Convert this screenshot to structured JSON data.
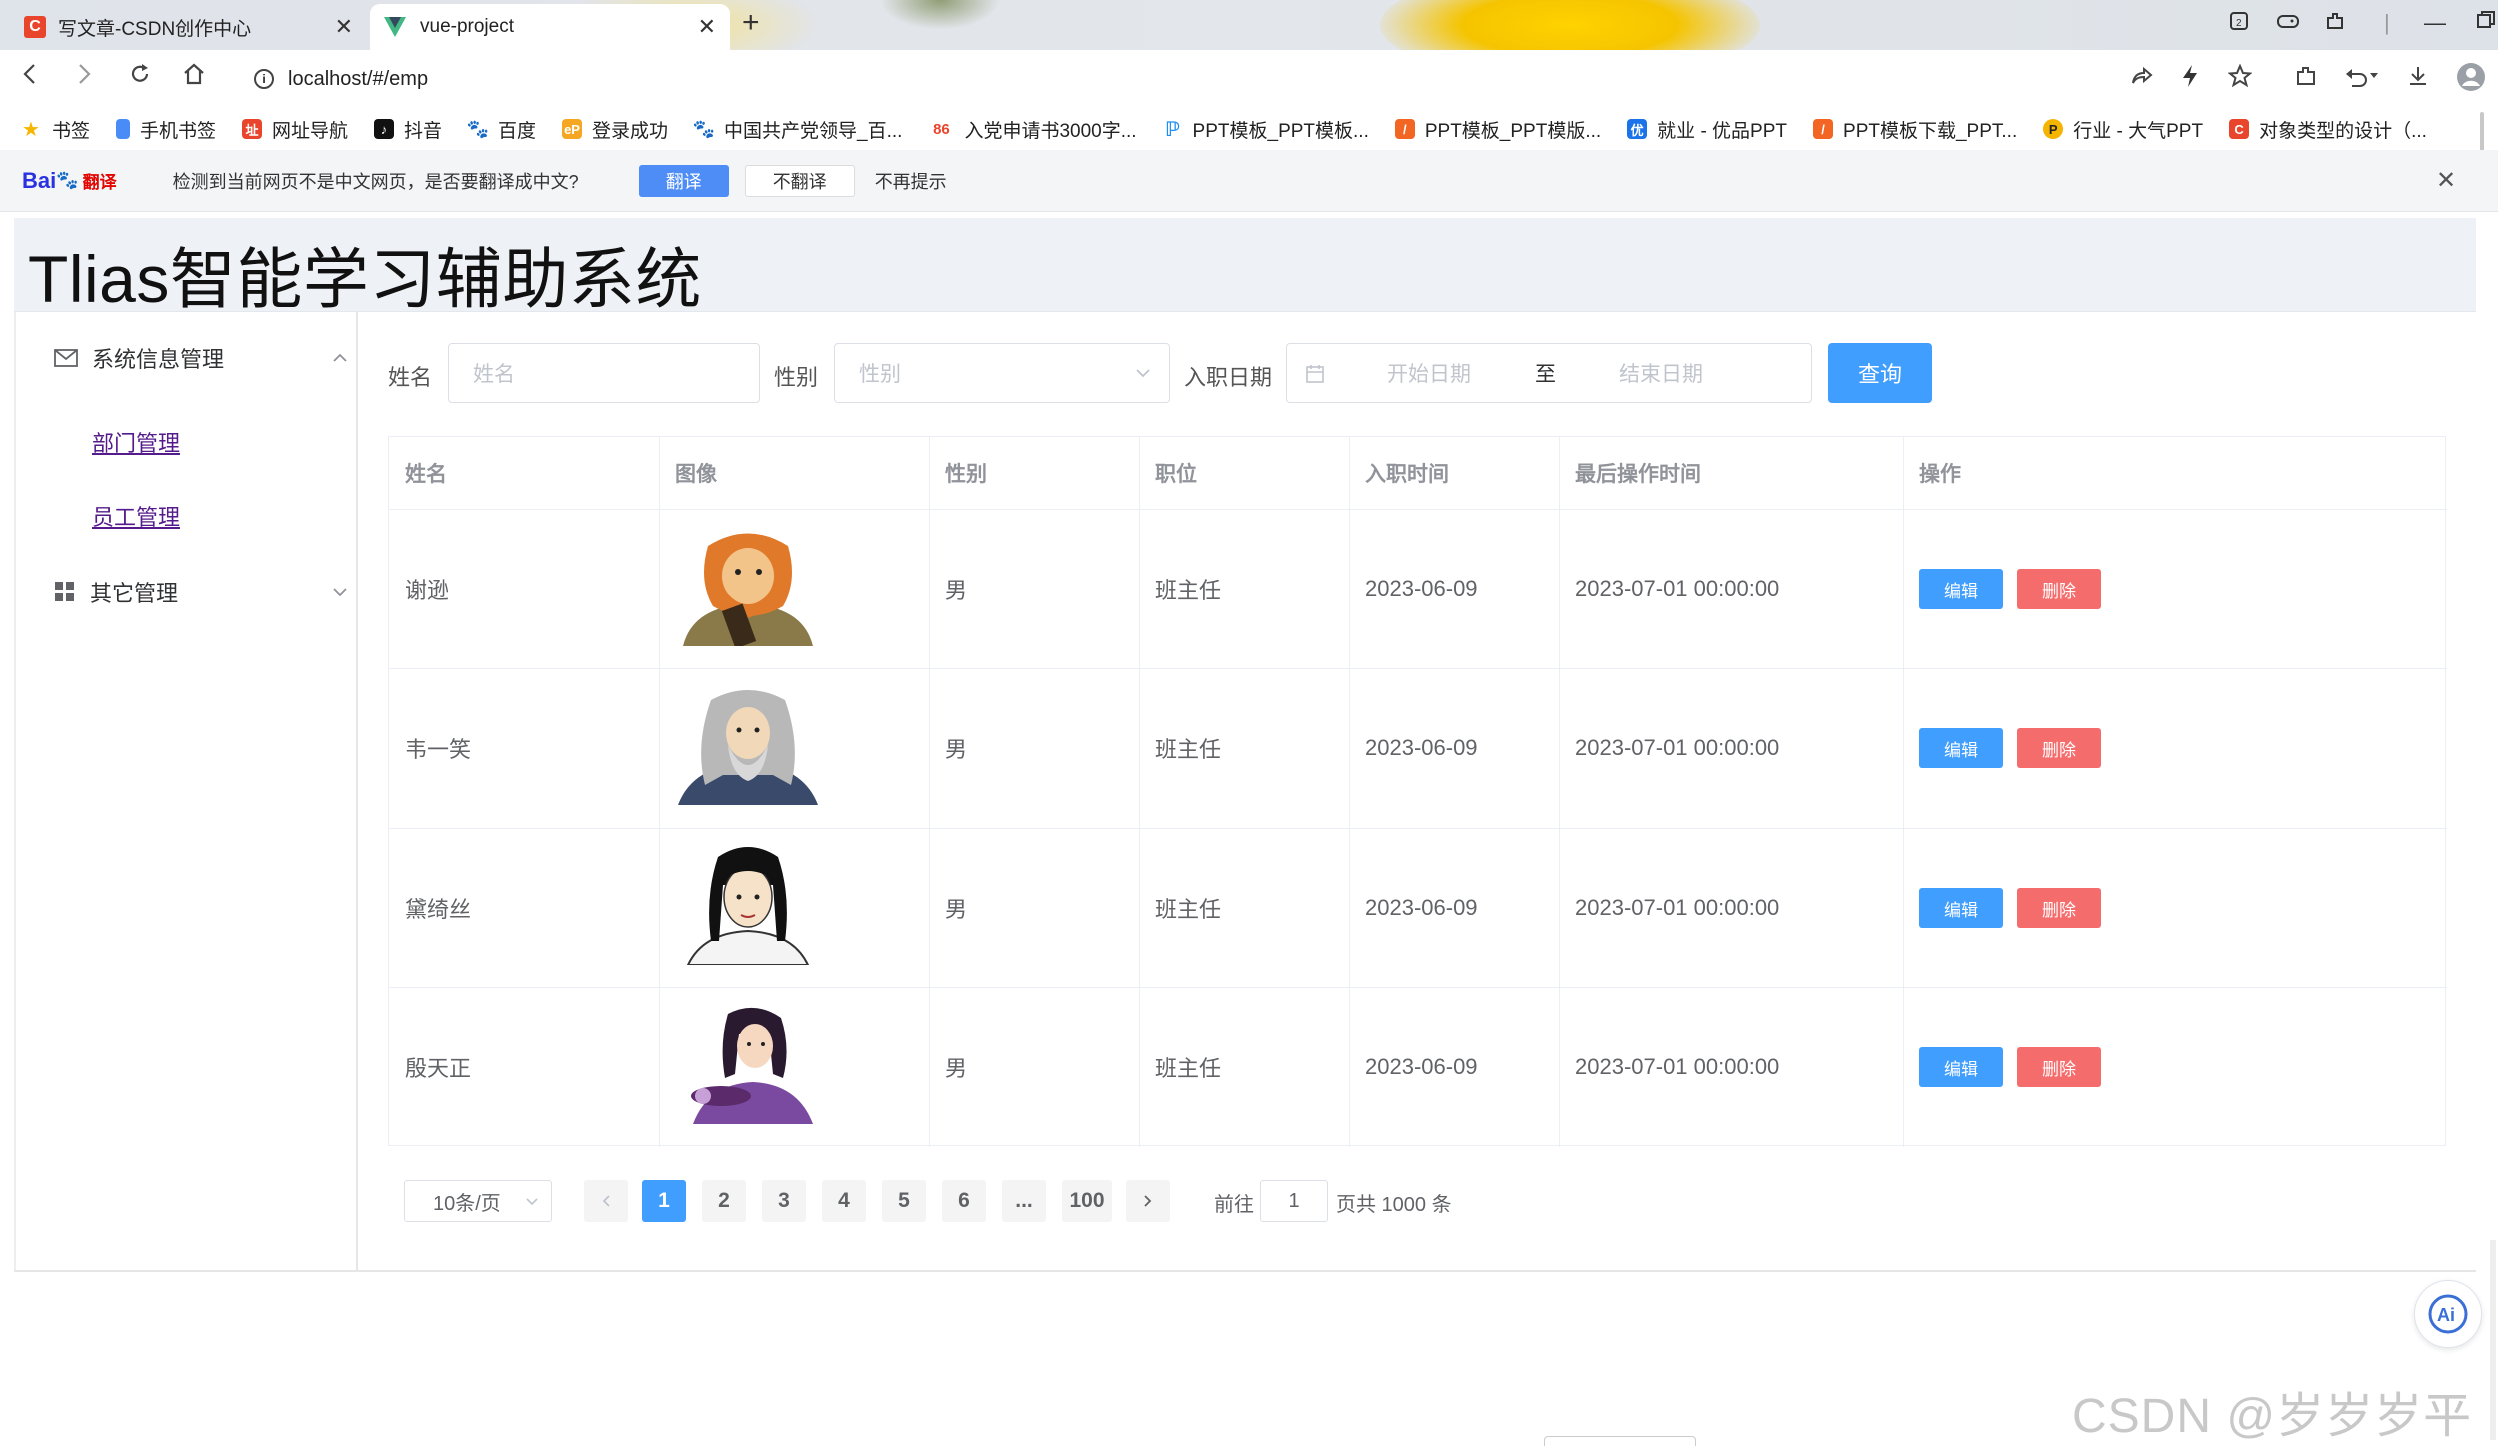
{
  "browser": {
    "tabs": [
      {
        "title": "写文章-CSDN创作中心",
        "icon": "csdn-icon"
      },
      {
        "title": "vue-project",
        "icon": "vue-icon"
      }
    ],
    "url": "localhost/#/emp",
    "bookmarks": [
      "书签",
      "手机书签",
      "网址导航",
      "抖音",
      "百度",
      "登录成功",
      "中国共产党领导_百...",
      "入党申请书3000字...",
      "PPT模板_PPT模板...",
      "PPT模板_PPT模版...",
      "就业 - 优品PPT",
      "PPT模板下载_PPT...",
      "行业 - 大气PPT",
      "对象类型的设计（..."
    ]
  },
  "translate_bar": {
    "logo": "Bai",
    "logo_suffix": "翻译",
    "message": "检测到当前网页不是中文网页，是否要翻译成中文?",
    "translate": "翻译",
    "no_translate": "不翻译",
    "no_remind": "不再提示"
  },
  "app": {
    "title": "Tlias智能学习辅助系统"
  },
  "sidebar": {
    "group1": "系统信息管理",
    "items": [
      "部门管理",
      "员工管理"
    ],
    "group2": "其它管理"
  },
  "search": {
    "name_label": "姓名",
    "name_placeholder": "姓名",
    "gender_label": "性别",
    "gender_placeholder": "性别",
    "date_label": "入职日期",
    "start_placeholder": "开始日期",
    "range_sep": "至",
    "end_placeholder": "结束日期",
    "query": "查询"
  },
  "table": {
    "headers": [
      "姓名",
      "图像",
      "性别",
      "职位",
      "入职时间",
      "最后操作时间",
      "操作"
    ],
    "rows": [
      {
        "name": "谢逊",
        "gender": "男",
        "job": "班主任",
        "entry": "2023-06-09",
        "updated": "2023-07-01 00:00:00"
      },
      {
        "name": "韦一笑",
        "gender": "男",
        "job": "班主任",
        "entry": "2023-06-09",
        "updated": "2023-07-01 00:00:00"
      },
      {
        "name": "黛绮丝",
        "gender": "男",
        "job": "班主任",
        "entry": "2023-06-09",
        "updated": "2023-07-01 00:00:00"
      },
      {
        "name": "殷天正",
        "gender": "男",
        "job": "班主任",
        "entry": "2023-06-09",
        "updated": "2023-07-01 00:00:00"
      }
    ],
    "edit": "编辑",
    "delete": "删除"
  },
  "pager": {
    "page_size": "10条/页",
    "pages": [
      "1",
      "2",
      "3",
      "4",
      "5",
      "6",
      "...",
      "100"
    ],
    "current": "1",
    "goto_label": "前往",
    "goto_value": "1",
    "total_text": "页共 1000 条"
  },
  "watermark": "CSDN @岁岁岁平安",
  "colors": {
    "primary": "#409eff",
    "danger": "#f56c6c"
  }
}
